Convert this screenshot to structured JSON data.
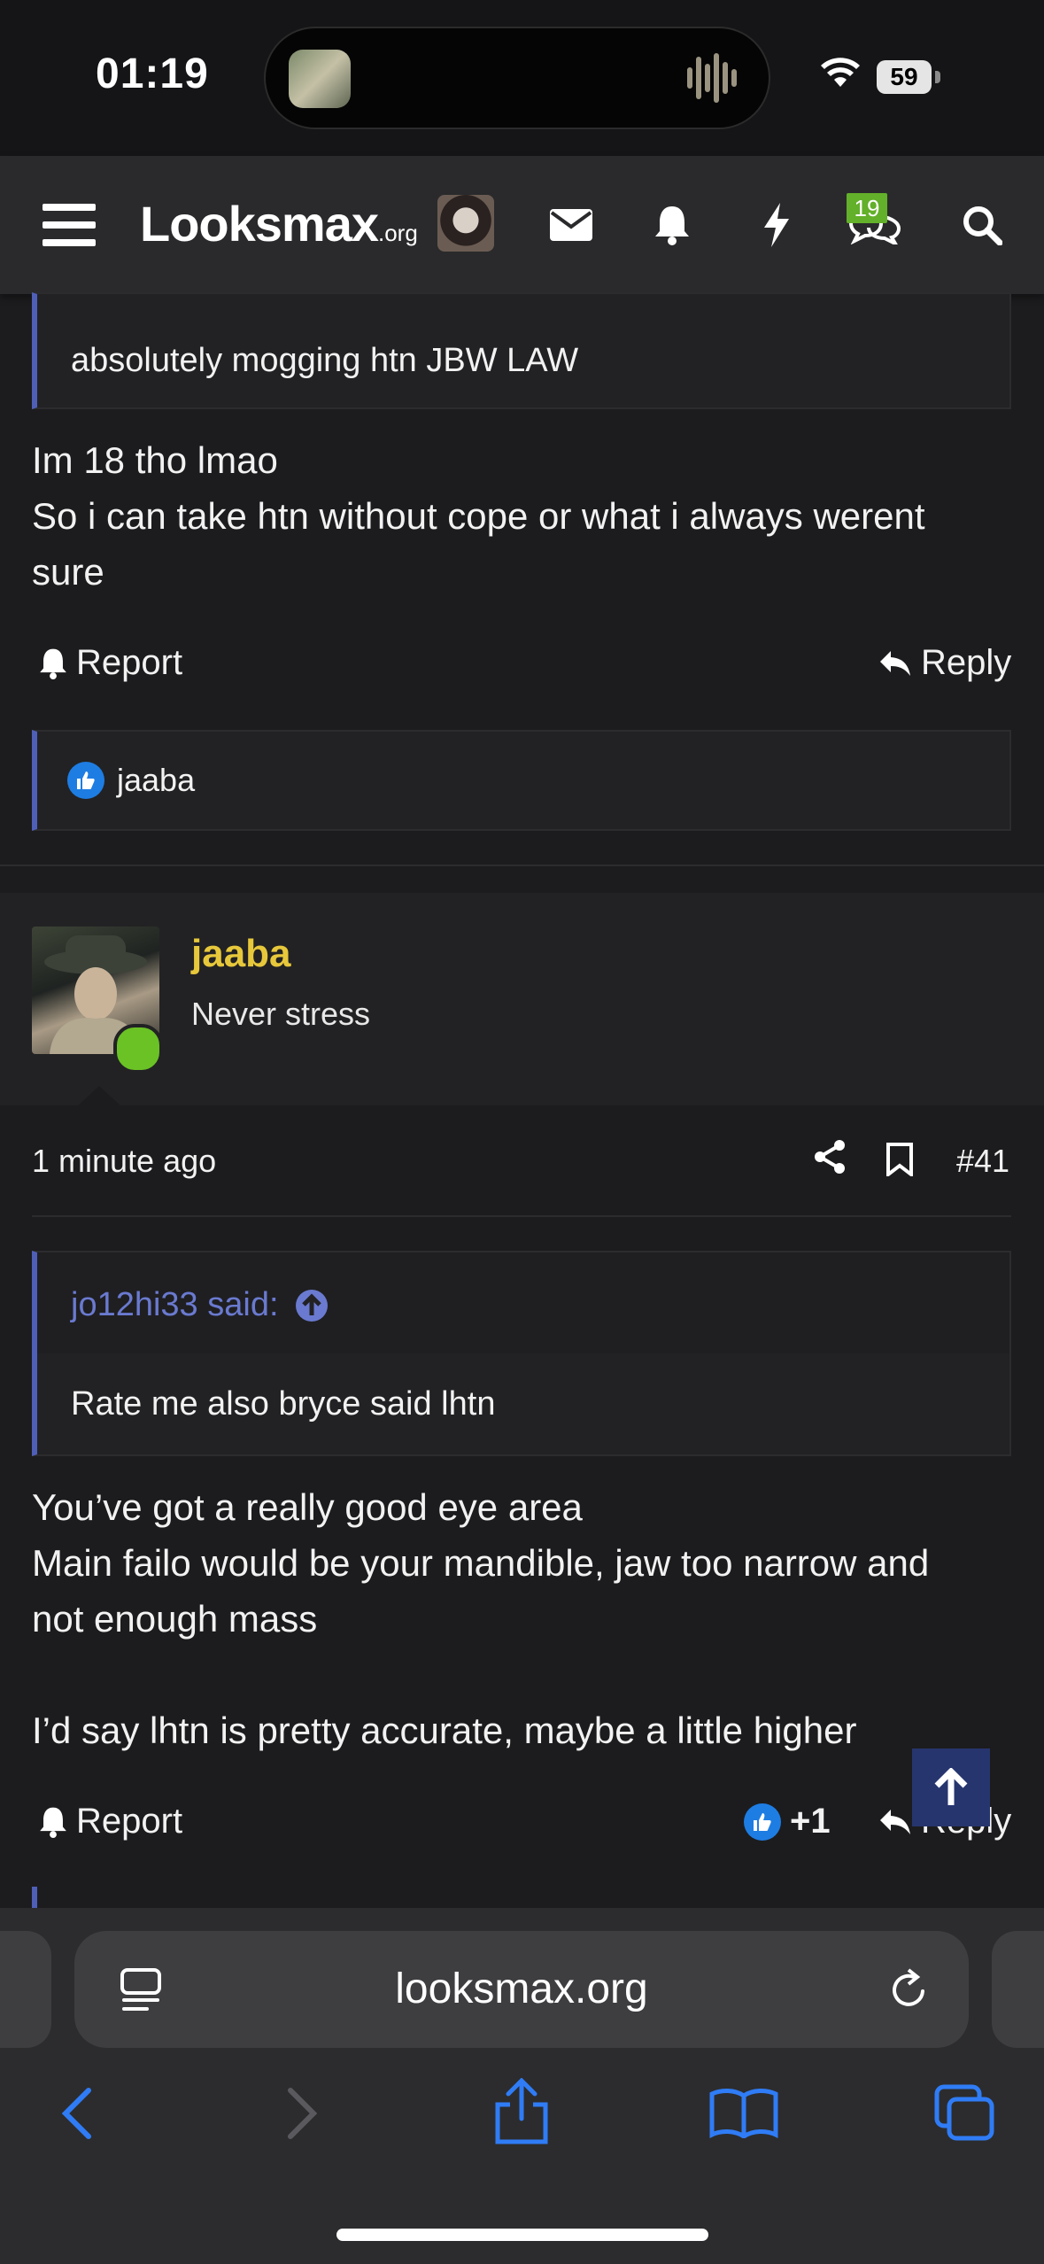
{
  "status_bar": {
    "time": "01:19",
    "battery": "59"
  },
  "nav": {
    "logo_main": "Looksmax",
    "logo_suffix": ".org",
    "chat_badge": "19"
  },
  "post1": {
    "quote_text": "absolutely mogging htn JBW LAW",
    "body_lines": [
      "Im 18 tho lmao",
      "So i can take htn without cope or what i always werent",
      "sure"
    ],
    "report_label": "Report",
    "reply_label": "Reply",
    "liked_by": "jaaba"
  },
  "post2": {
    "username": "jaaba",
    "user_title": "Never stress",
    "time_ago": "1 minute ago",
    "post_number": "#41",
    "quote_author": "jo12hi33 said:",
    "quote_text": "Rate me also bryce said lhtn",
    "body_lines": [
      "You’ve got a really good eye area",
      "Main failo would be your mandible, jaw too narrow and",
      "not enough mass",
      "",
      "I’d say lhtn is pretty accurate, maybe a little higher"
    ],
    "report_label": "Report",
    "like_count": "+1",
    "reply_label": "Reply"
  },
  "browser": {
    "url": "looksmax.org"
  },
  "colors": {
    "accent_quote": "#4f5fb8",
    "username": "#e7c83b",
    "online": "#6ac225",
    "link_blue": "#2f7cf6"
  }
}
